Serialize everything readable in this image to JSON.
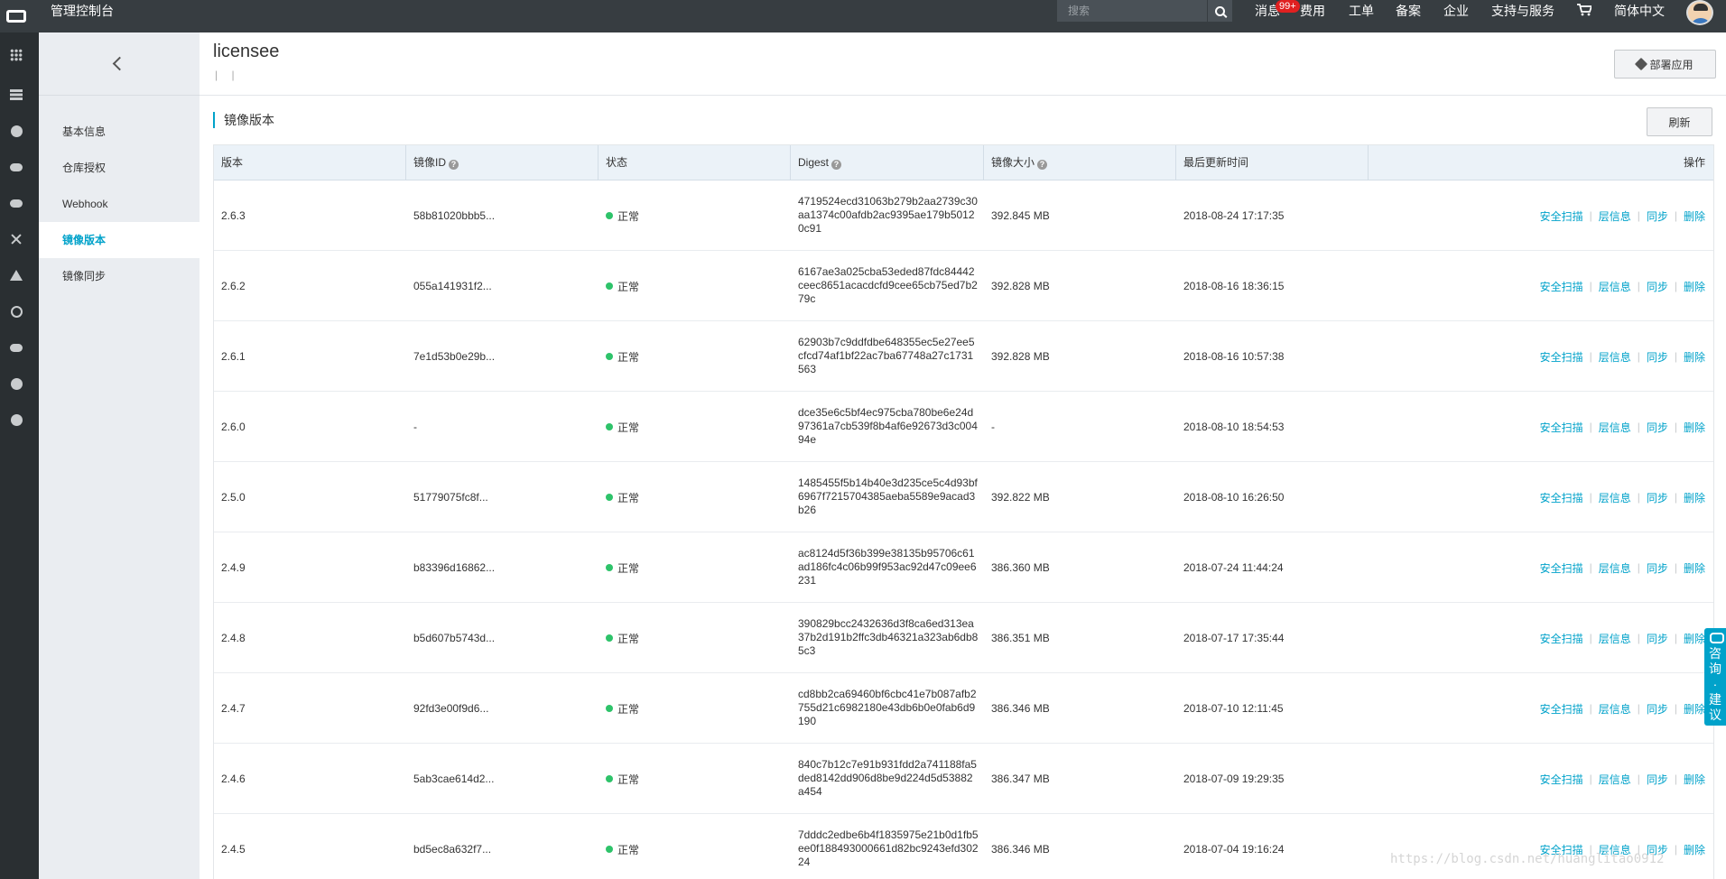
{
  "topbar": {
    "console_title": "管理控制台",
    "search_placeholder": "搜索",
    "nav": {
      "messages": "消息",
      "messages_badge": "99+",
      "billing": "费用",
      "tickets": "工单",
      "icp": "备案",
      "enterprise": "企业",
      "support": "支持与服务",
      "language": "简体中文"
    }
  },
  "sidebar": {
    "items": [
      {
        "label": "基本信息"
      },
      {
        "label": "仓库授权"
      },
      {
        "label": "Webhook"
      },
      {
        "label": "镜像版本"
      },
      {
        "label": "镜像同步"
      }
    ],
    "active_index": 3
  },
  "header": {
    "title": "licensee",
    "subtitle": "| |",
    "deploy_label": "部署应用"
  },
  "section": {
    "title": "镜像版本",
    "refresh_label": "刷新"
  },
  "table": {
    "columns": [
      "版本",
      "镜像ID",
      "状态",
      "Digest",
      "镜像大小",
      "最后更新时间",
      "操作"
    ],
    "actions": [
      "安全扫描",
      "层信息",
      "同步",
      "删除"
    ],
    "rows": [
      {
        "version": "2.6.3",
        "image_id": "58b81020bbb5...",
        "status": "正常",
        "digest": "4719524ecd31063b279b2aa2739c30aa1374c00afdb2ac9395ae179b50120c91",
        "size": "392.845 MB",
        "updated": "2018-08-24 17:17:35"
      },
      {
        "version": "2.6.2",
        "image_id": "055a141931f2...",
        "status": "正常",
        "digest": "6167ae3a025cba53eded87fdc84442ceec8651acacdcfd9cee65cb75ed7b279c",
        "size": "392.828 MB",
        "updated": "2018-08-16 18:36:15"
      },
      {
        "version": "2.6.1",
        "image_id": "7e1d53b0e29b...",
        "status": "正常",
        "digest": "62903b7c9ddfdbe648355ec5e27ee5cfcd74af1bf22ac7ba67748a27c1731563",
        "size": "392.828 MB",
        "updated": "2018-08-16 10:57:38"
      },
      {
        "version": "2.6.0",
        "image_id": "-",
        "status": "正常",
        "digest": "dce35e6c5bf4ec975cba780be6e24d97361a7cb539f8b4af6e92673d3c00494e",
        "size": "-",
        "updated": "2018-08-10 18:54:53"
      },
      {
        "version": "2.5.0",
        "image_id": "51779075fc8f...",
        "status": "正常",
        "digest": "1485455f5b14b40e3d235ce5c4d93bf6967f7215704385aeba5589e9acad3b26",
        "size": "392.822 MB",
        "updated": "2018-08-10 16:26:50"
      },
      {
        "version": "2.4.9",
        "image_id": "b83396d16862...",
        "status": "正常",
        "digest": "ac8124d5f36b399e38135b95706c61ad186fc4c06b99f953ac92d47c09ee6231",
        "size": "386.360 MB",
        "updated": "2018-07-24 11:44:24"
      },
      {
        "version": "2.4.8",
        "image_id": "b5d607b5743d...",
        "status": "正常",
        "digest": "390829bcc2432636d3f8ca6ed313ea37b2d191b2ffc3db46321a323ab6db85c3",
        "size": "386.351 MB",
        "updated": "2018-07-17 17:35:44"
      },
      {
        "version": "2.4.7",
        "image_id": "92fd3e00f9d6...",
        "status": "正常",
        "digest": "cd8bb2ca69460bf6cbc41e7b087afb2755d21c6982180e43db6b0e0fab6d9190",
        "size": "386.346 MB",
        "updated": "2018-07-10 12:11:45"
      },
      {
        "version": "2.4.6",
        "image_id": "5ab3cae614d2...",
        "status": "正常",
        "digest": "840c7b12c7e91b931fdd2a741188fa5ded8142dd906d8be9d224d5d53882a454",
        "size": "386.347 MB",
        "updated": "2018-07-09 19:29:35"
      },
      {
        "version": "2.4.5",
        "image_id": "bd5ec8a632f7...",
        "status": "正常",
        "digest": "7dddc2edbe6b4f1835975e21b0d1fb5ee0f188493000661d82bc9243efd30224",
        "size": "386.346 MB",
        "updated": "2018-07-04 19:16:24"
      }
    ]
  },
  "consult": {
    "label": "咨询·建议"
  },
  "watermark": "https://blog.csdn.net/huanglitao0912"
}
